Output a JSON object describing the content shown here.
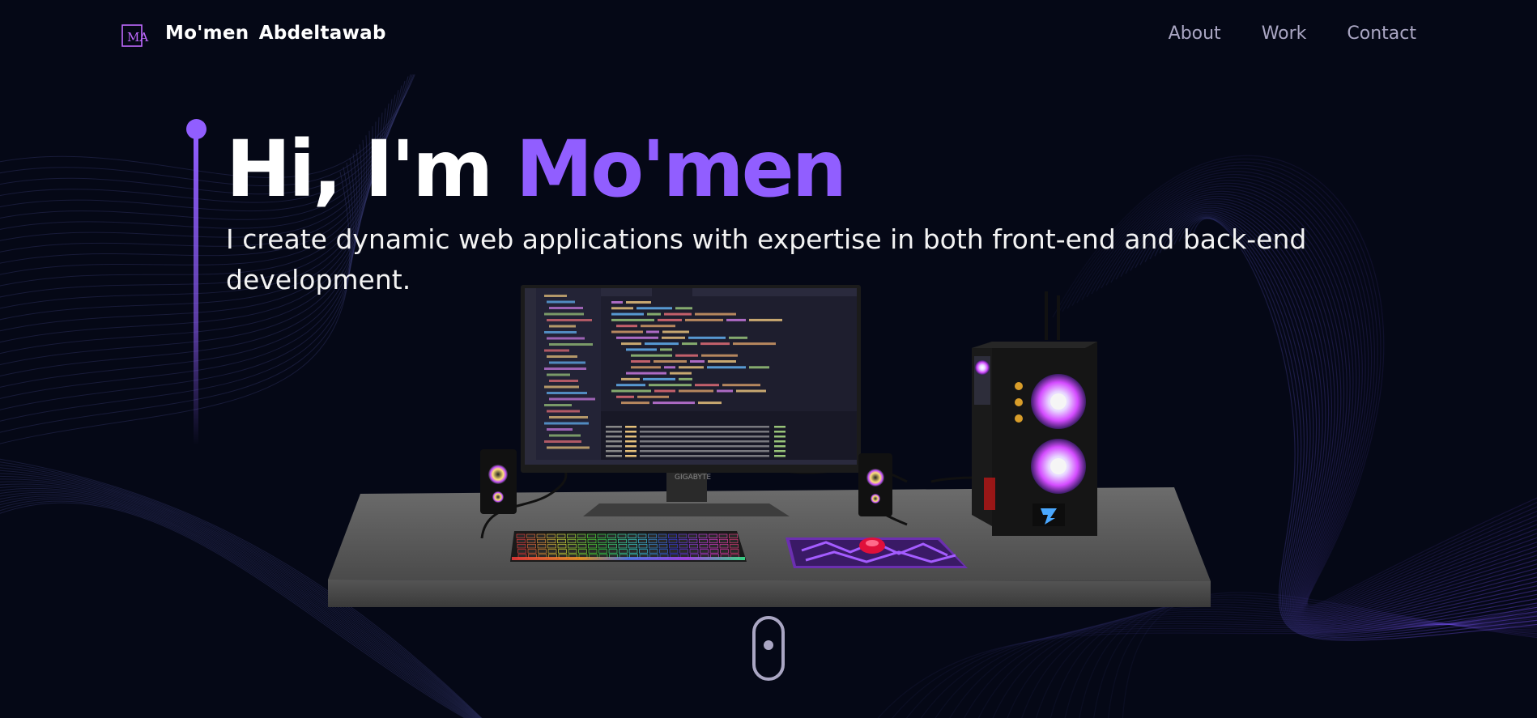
{
  "nav": {
    "brand_name": "Mo'men Abdeltawab",
    "logo_initials": "MA",
    "links": [
      {
        "label": "About"
      },
      {
        "label": "Work"
      },
      {
        "label": "Contact"
      }
    ]
  },
  "hero": {
    "greeting": "Hi, I'm ",
    "name": "Mo'men",
    "subtitle": "I create dynamic web applications with expertise in both front-end and back-end development."
  },
  "scene": {
    "monitor_brand": "GIGABYTE"
  },
  "colors": {
    "background": "#050816",
    "accent": "#915eff",
    "nav_text": "#aaa6c3",
    "text": "#ffffff"
  },
  "icons": {
    "logo": "ma-logo-icon",
    "scroll": "mouse-scroll-icon"
  }
}
